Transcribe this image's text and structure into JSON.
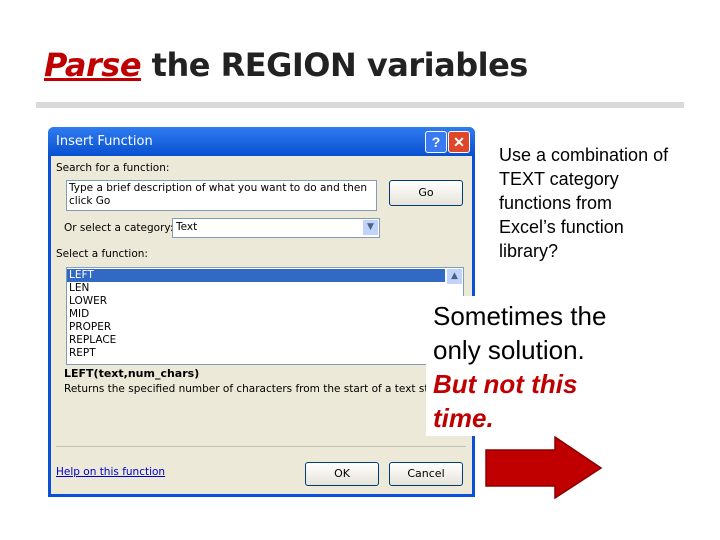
{
  "slide": {
    "title_keyword": "Parse",
    "title_rest": " the REGION variables",
    "side_text": [
      "Use a combination of",
      "TEXT category",
      "functions from",
      "Excel’s function",
      "library?"
    ],
    "note": {
      "line1": "Sometimes the",
      "line2": "only solution.",
      "line3": "But not this",
      "line4": "time."
    },
    "accent": "#c00000"
  },
  "dialog": {
    "title": "Insert Function",
    "help_icon": "?",
    "close_icon": "✕",
    "search_label": "Search for a function:",
    "search_value": "Type a brief description of what you want to do and then click Go",
    "go_label": "Go",
    "category_label": "Or select a category:",
    "category_value": "Text",
    "function_label": "Select a function:",
    "functions": [
      "LEFT",
      "LEN",
      "LOWER",
      "MID",
      "PROPER",
      "REPLACE",
      "REPT"
    ],
    "signature": "LEFT(text,num_chars)",
    "description": "Returns the specified number of characters from the start of a text string.",
    "help_link": "Help on this function",
    "ok_label": "OK",
    "cancel_label": "Cancel"
  }
}
